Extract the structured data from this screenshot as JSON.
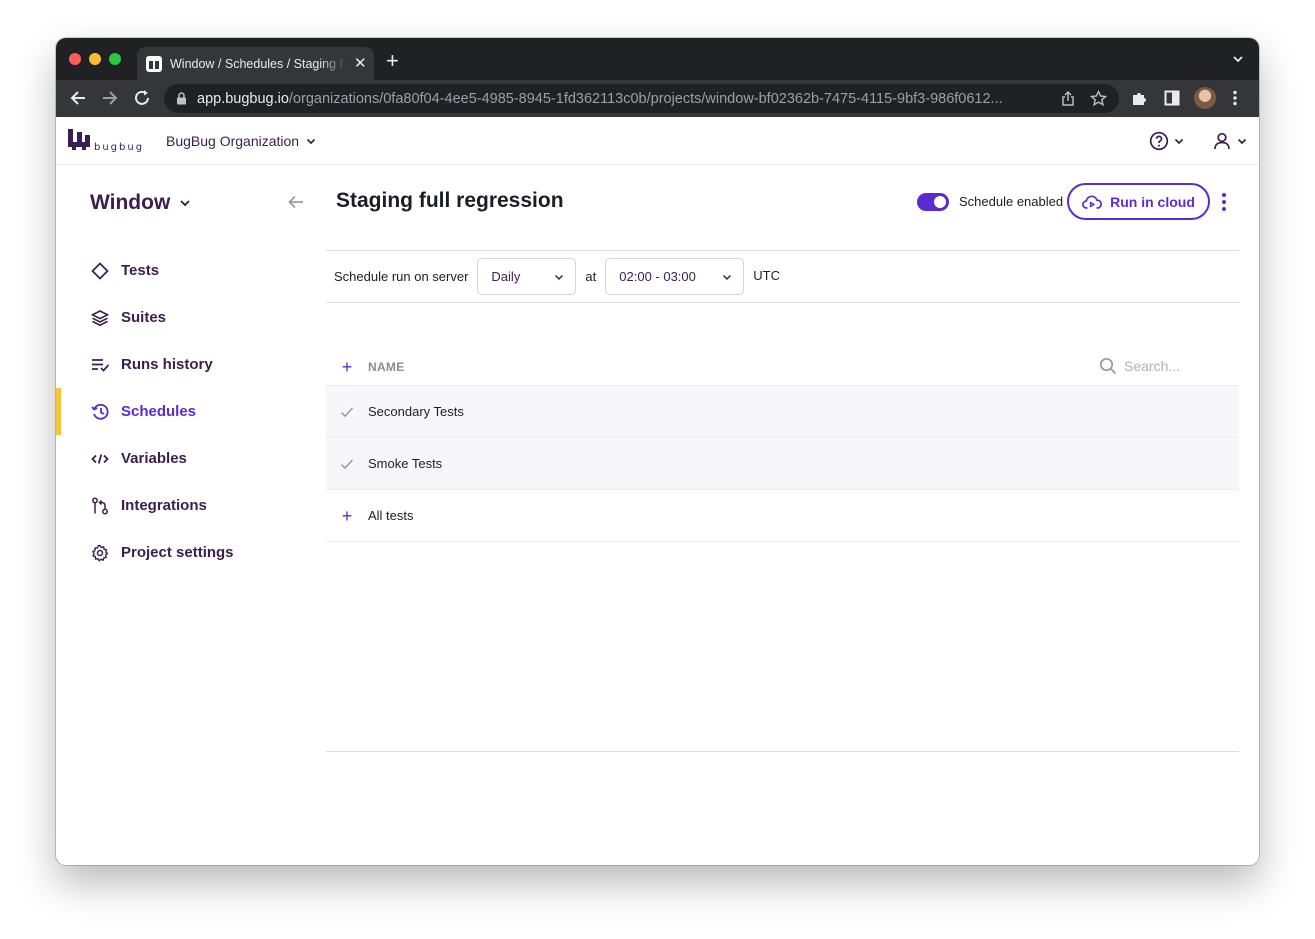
{
  "browser": {
    "tab_title": "Window / Schedules / Staging full regression",
    "url_host": "app.bugbug.io",
    "url_path": "/organizations/0fa80f04-4ee5-4985-8945-1fd362113c0b/projects/window-bf02362b-7475-4115-9bf3-986f0612..."
  },
  "header": {
    "logo_text": "bugbug",
    "organization": "BugBug Organization"
  },
  "sidebar": {
    "project": "Window",
    "items": [
      {
        "label": "Tests"
      },
      {
        "label": "Suites"
      },
      {
        "label": "Runs history"
      },
      {
        "label": "Schedules"
      },
      {
        "label": "Variables"
      },
      {
        "label": "Integrations"
      },
      {
        "label": "Project settings"
      }
    ],
    "active_item": "Schedules"
  },
  "main": {
    "title": "Staging full regression",
    "schedule_toggle_label": "Schedule enabled",
    "run_button": "Run in cloud",
    "schedule_label": "Schedule run on server",
    "frequency": "Daily",
    "at_label": "at",
    "time_window": "02:00 - 03:00",
    "timezone": "UTC",
    "table": {
      "column_name": "NAME",
      "search_placeholder": "Search...",
      "rows": [
        {
          "name": "Secondary Tests",
          "selected": true
        },
        {
          "name": "Smoke Tests",
          "selected": true
        },
        {
          "name": "All tests",
          "selected": false
        }
      ]
    }
  },
  "colors": {
    "accent": "#5a2bd3",
    "brand_dark": "#3c1e4e",
    "active_marker": "#f9c43c"
  }
}
